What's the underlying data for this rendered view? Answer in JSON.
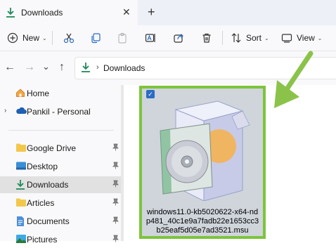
{
  "tab": {
    "title": "Downloads",
    "close_glyph": "✕",
    "new_tab_glyph": "+"
  },
  "toolbar": {
    "new_label": "New",
    "sort_label": "Sort",
    "view_label": "View",
    "chevron_glyph": "⌄",
    "icons": [
      "cut-icon",
      "copy-icon",
      "paste-icon",
      "rename-icon",
      "share-icon",
      "delete-icon",
      "sort-icon",
      "view-icon"
    ]
  },
  "address": {
    "path": "Downloads",
    "separator": "›",
    "nav": {
      "back": "←",
      "forward": "→",
      "recent": "⌄",
      "up": "↑"
    }
  },
  "sidebar": {
    "expand_glyph": "›",
    "pin_glyph": "📌",
    "items": [
      {
        "label": "Home",
        "icon": "home-icon"
      },
      {
        "label": "Pankil - Personal",
        "icon": "cloud-icon"
      },
      {
        "label": "Google Drive",
        "icon": "folder-icon",
        "pinned": true
      },
      {
        "label": "Desktop",
        "icon": "desktop-icon",
        "pinned": true
      },
      {
        "label": "Downloads",
        "icon": "download-icon",
        "pinned": true,
        "selected": true
      },
      {
        "label": "Articles",
        "icon": "folder-icon",
        "pinned": true
      },
      {
        "label": "Documents",
        "icon": "documents-icon",
        "pinned": true
      },
      {
        "label": "Pictures",
        "icon": "pictures-icon",
        "pinned": true
      }
    ]
  },
  "file": {
    "name": "windows11.0-kb5020622-x64-ndp481_40c1e9a7fadb22e1653cc3b25eaf5d05e7ad3521.msu",
    "checked": true,
    "check_glyph": "✓"
  },
  "colors": {
    "accent": "#2b6cc4",
    "highlight_border": "#7dc43c",
    "arrow": "#8bc34a",
    "selected_bg": "#e1e1e1"
  }
}
